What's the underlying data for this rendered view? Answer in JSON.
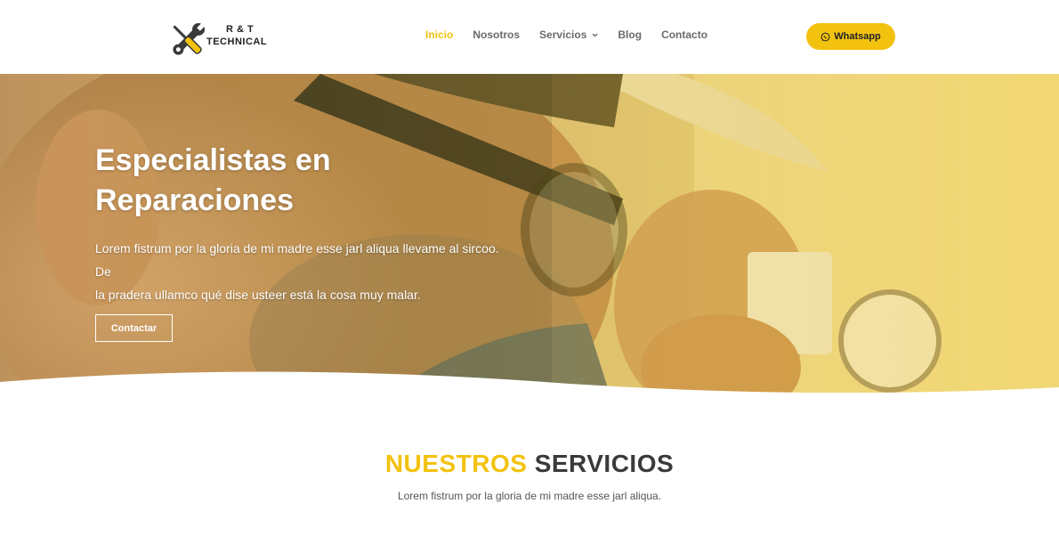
{
  "logo": {
    "line1": "R & T",
    "line2": "TECHNICAL"
  },
  "nav": {
    "items": [
      {
        "label": "Inicio"
      },
      {
        "label": "Nosotros"
      },
      {
        "label": "Servicios"
      },
      {
        "label": "Blog"
      },
      {
        "label": "Contacto"
      }
    ],
    "active": "Inicio"
  },
  "whatsapp_button": {
    "label": "Whatsapp"
  },
  "hero": {
    "title_line1": "Especialistas en",
    "title_line2": "Reparaciones",
    "text_line1": "Lorem fistrum por la gloria de mi madre esse jarl aliqua llevame al sircoo. De",
    "text_line2": "la pradera ullamco qué dise usteer está la cosa muy malar.",
    "button_label": "Contactar"
  },
  "services": {
    "title_highlight": "NUESTROS",
    "title_rest": "SERVICIOS",
    "subtitle": "Lorem fistrum por la gloria de mi madre esse jarl aliqua."
  },
  "colors": {
    "accent": "#f2c20f",
    "nav_text": "#6b6b6b",
    "heading_dark": "#3a3a3a"
  }
}
